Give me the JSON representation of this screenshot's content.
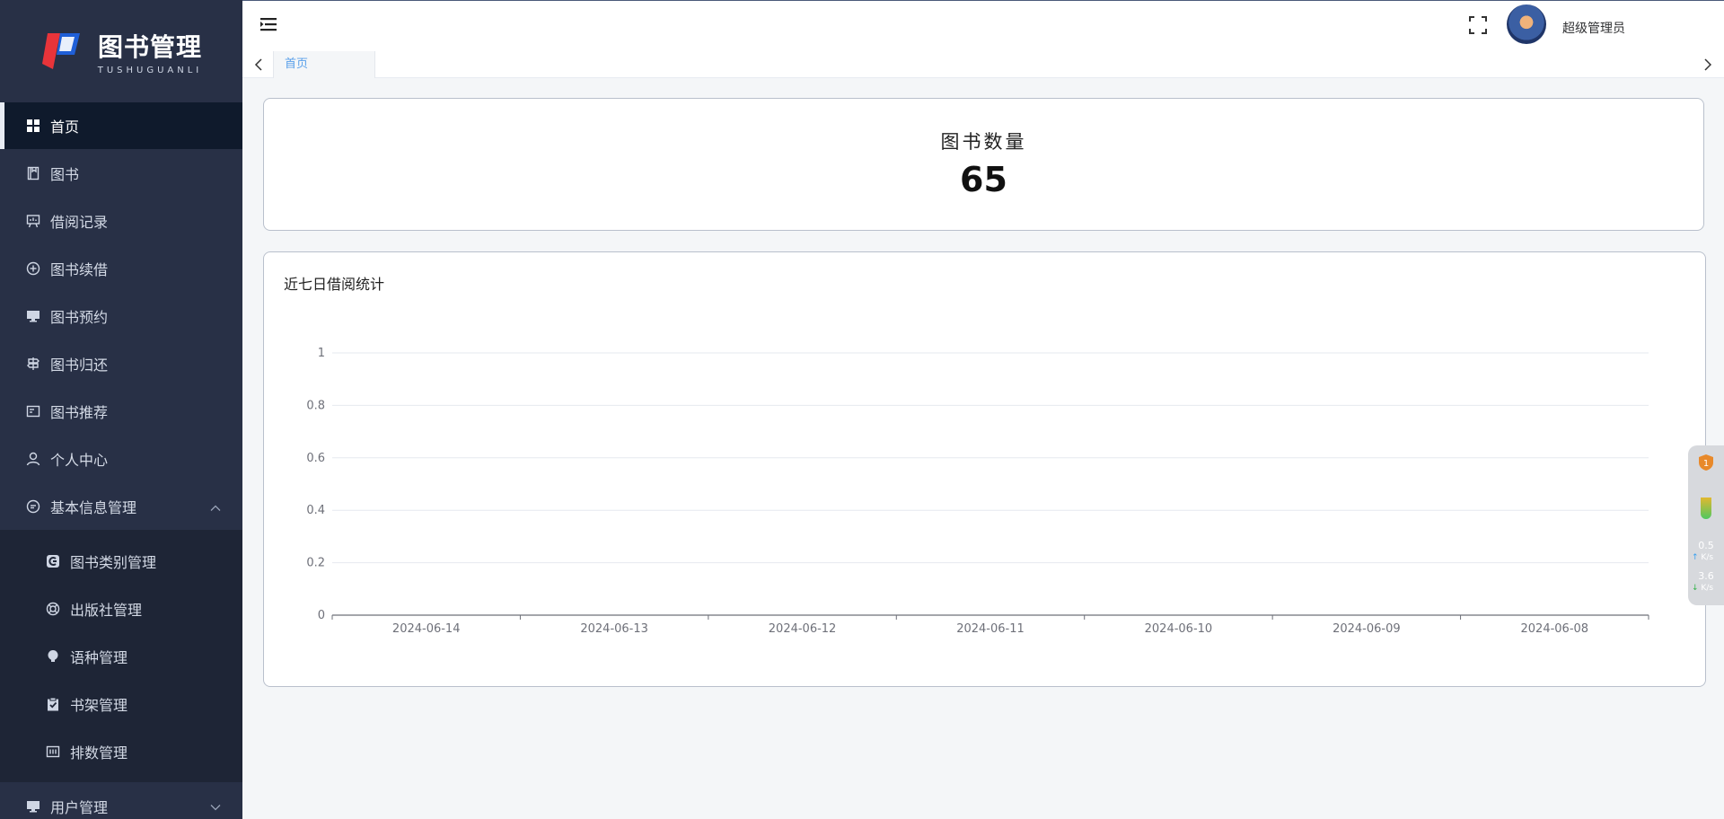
{
  "brand": {
    "title": "图书管理",
    "subtitle": "TUSHUGUANLI"
  },
  "header": {
    "username": "超级管理员"
  },
  "tabs": [
    {
      "label": "首页"
    }
  ],
  "sidebar": {
    "items": [
      {
        "label": "首页",
        "icon": "dashboard-grid-icon"
      },
      {
        "label": "图书",
        "icon": "book-icon"
      },
      {
        "label": "借阅记录",
        "icon": "presentation-icon"
      },
      {
        "label": "图书续借",
        "icon": "circle-plus-icon"
      },
      {
        "label": "图书预约",
        "icon": "monitor-icon"
      },
      {
        "label": "图书归还",
        "icon": "signpost-icon"
      },
      {
        "label": "图书推荐",
        "icon": "card-icon"
      },
      {
        "label": "个人中心",
        "icon": "user-icon"
      },
      {
        "label": "基本信息管理",
        "icon": "chat-bubble-icon"
      }
    ],
    "submenu": [
      {
        "label": "图书类别管理",
        "icon": "category-icon"
      },
      {
        "label": "出版社管理",
        "icon": "lifebuoy-icon"
      },
      {
        "label": "语种管理",
        "icon": "bulb-icon"
      },
      {
        "label": "书架管理",
        "icon": "clipboard-check-icon"
      },
      {
        "label": "排数管理",
        "icon": "rows-icon"
      }
    ],
    "user_menu": {
      "label": "用户管理",
      "icon": "monitor-icon"
    }
  },
  "stats": {
    "label": "图书数量",
    "value": "65"
  },
  "chart_title": "近七日借阅统计",
  "chart_data": {
    "type": "bar",
    "title": "近七日借阅统计",
    "categories": [
      "2024-06-14",
      "2024-06-13",
      "2024-06-12",
      "2024-06-11",
      "2024-06-10",
      "2024-06-09",
      "2024-06-08"
    ],
    "values": [
      0,
      0,
      0,
      0,
      0,
      0,
      0
    ],
    "yticks": [
      "0",
      "0.2",
      "0.4",
      "0.6",
      "0.8",
      "1"
    ],
    "ylim": [
      0,
      1
    ],
    "grid": true
  },
  "widget": {
    "badge": "1",
    "up": "0.5",
    "down": "3.6",
    "unit": "K/s"
  },
  "colors": {
    "sidebar": "#283046",
    "active": "#0f1a2c",
    "accent": "#5aa0ea"
  }
}
